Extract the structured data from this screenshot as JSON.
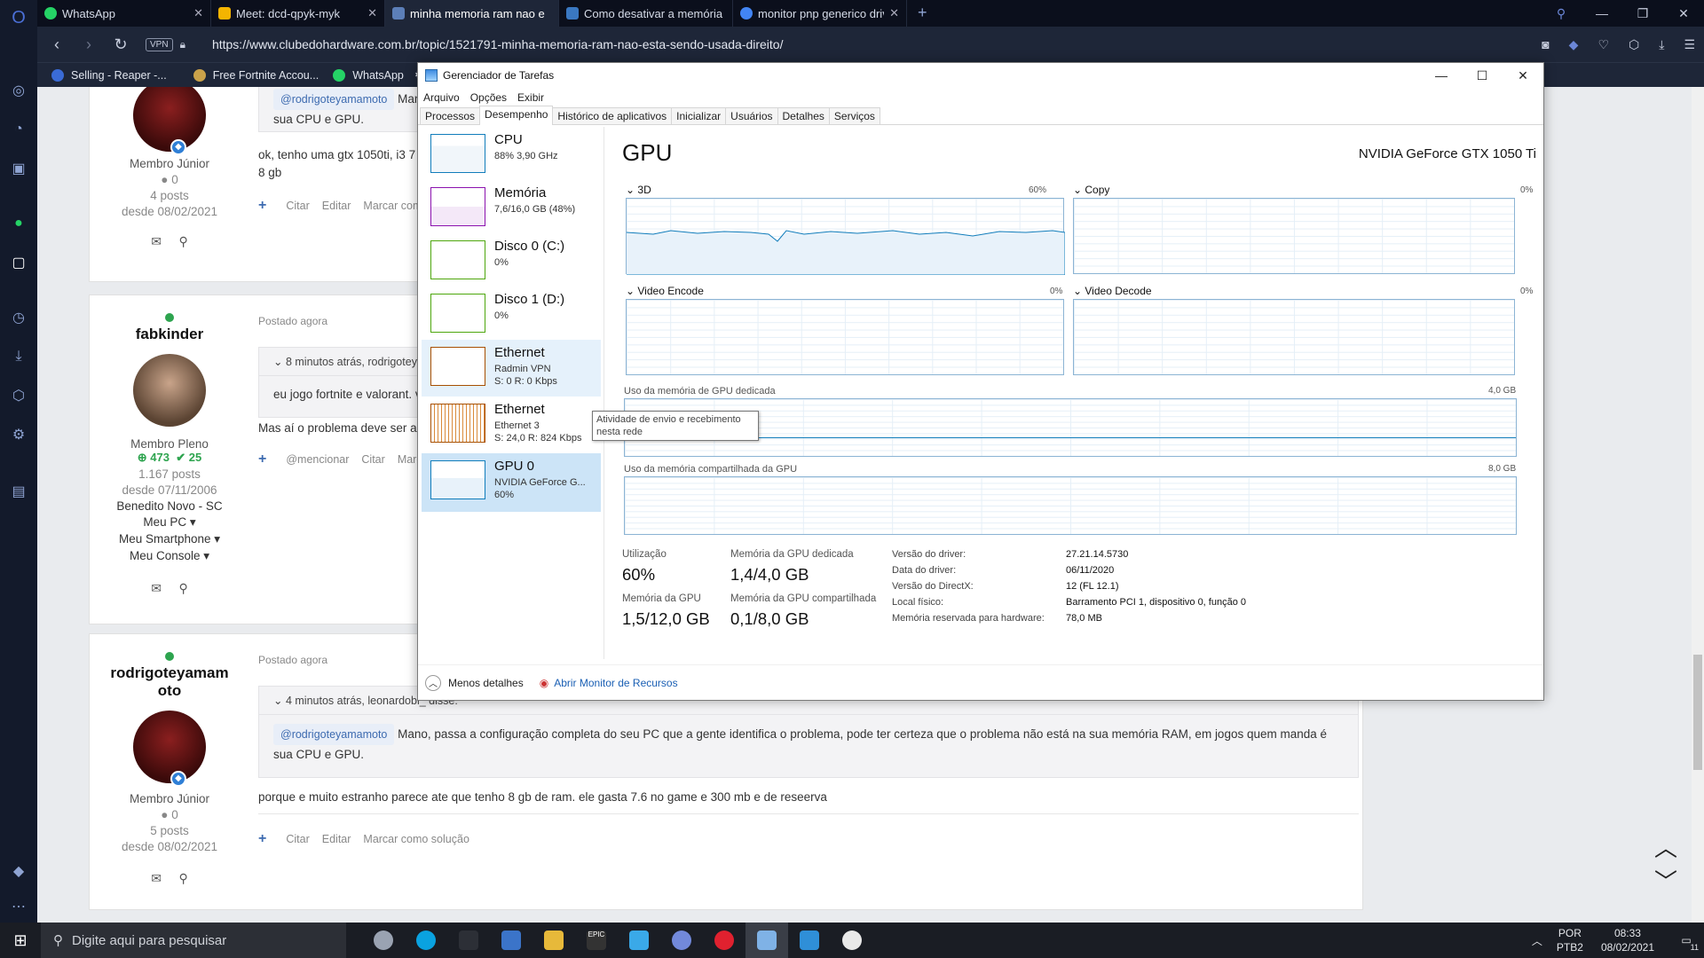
{
  "browser": {
    "tabs": [
      {
        "label": "WhatsApp",
        "color": "#25d366"
      },
      {
        "label": "Meet: dcd-qpyk-myk",
        "color": "#f4b400"
      },
      {
        "label": "minha memoria ram nao e",
        "color": "#5c7fb8"
      },
      {
        "label": "Como desativar a memória",
        "color": "#3a78c2"
      },
      {
        "label": "monitor pnp generico driv",
        "color": "#4285f4"
      }
    ],
    "vpn_label": "VPN",
    "url": "https://www.clubedohardware.com.br/topic/1521791-minha-memoria-ram-nao-esta-sendo-usada-direito/",
    "bookmarks": [
      {
        "label": "Selling - Reaper -...",
        "color": "#3a6bd6"
      },
      {
        "label": "Free Fortnite Accou...",
        "color": "#caa24a"
      },
      {
        "label": "WhatsApp",
        "color": "#25d366"
      }
    ]
  },
  "forum": {
    "posts": [
      {
        "author_rank": "Membro Júnior",
        "reputation": "0",
        "posts": "4 posts",
        "since": "desde 08/02/2021",
        "quote_mention": "@rodrigoteyamamoto",
        "quote_text": "Mano, passa a configuração completa do seu PC que a gente identifica o problema, pode ter certeza que o problema não está na sua memória RAM, em jogos quem manda é sua CPU e GPU.",
        "text": "ok, tenho uma gtx 1050ti, i3 7 g",
        "text2": "8 gb",
        "actions": [
          "Citar",
          "Editar",
          "Marcar como solução"
        ]
      },
      {
        "author": "fabkinder",
        "posted": "Postado agora",
        "quote_head": "8 minutos atrás, rodrigoteyamamoto disse:",
        "quote_text": "eu jogo fortnite e valorant. va",
        "text": "Mas aí o problema deve ser a p",
        "author_rank": "Membro Pleno",
        "rep_plus": "473",
        "rep_check": "25",
        "posts": "1.167 posts",
        "since": "desde 07/11/2006",
        "location": "Benedito Novo - SC",
        "links": [
          "Meu PC",
          "Meu Smartphone",
          "Meu Console"
        ],
        "actions": [
          "@mencionar",
          "Citar",
          "Marc"
        ]
      },
      {
        "author": "rodrigoteyamamoto",
        "posted": "Postado agora",
        "quote_head": "4 minutos atrás, leonardobl_ disse:",
        "quote_mention": "@rodrigoteyamamoto",
        "quote_text": "Mano, passa a configuração completa do seu PC que a gente identifica o problema, pode ter certeza que o problema não está na sua memória RAM, em jogos quem manda é sua CPU e GPU.",
        "text": "porque e muito estranho parece ate que tenho 8 gb de ram. ele gasta 7.6 no game e 300 mb e de reseerva",
        "author_rank": "Membro Júnior",
        "reputation": "0",
        "posts": "5 posts",
        "since": "desde 08/02/2021",
        "actions": [
          "Citar",
          "Editar",
          "Marcar como solução"
        ]
      }
    ]
  },
  "taskmanager": {
    "title": "Gerenciador de Tarefas",
    "menu": [
      "Arquivo",
      "Opções",
      "Exibir"
    ],
    "tabs": [
      "Processos",
      "Desempenho",
      "Histórico de aplicativos",
      "Inicializar",
      "Usuários",
      "Detalhes",
      "Serviços"
    ],
    "resources": [
      {
        "name": "CPU",
        "sub1": "88% 3,90 GHz",
        "sub2": "",
        "sub3": "",
        "color": "#117dbb"
      },
      {
        "name": "Memória",
        "sub1": "7,6/16,0 GB (48%)",
        "sub2": "",
        "sub3": "",
        "color": "#8b12ae"
      },
      {
        "name": "Disco 0 (C:)",
        "sub1": "0%",
        "sub2": "",
        "sub3": "",
        "color": "#4da60c"
      },
      {
        "name": "Disco 1 (D:)",
        "sub1": "0%",
        "sub2": "",
        "sub3": "",
        "color": "#4da60c"
      },
      {
        "name": "Ethernet",
        "sub1": "Radmin VPN",
        "sub2": "S: 0 R: 0 Kbps",
        "sub3": "",
        "color": "#a74f01"
      },
      {
        "name": "Ethernet",
        "sub1": "Ethernet 3",
        "sub2": "S: 24,0 R: 824 Kbps",
        "sub3": "",
        "color": "#a74f01"
      },
      {
        "name": "GPU 0",
        "sub1": "NVIDIA GeForce G...",
        "sub2": "60%",
        "sub3": "",
        "color": "#117dbb"
      }
    ],
    "gpu_title": "GPU",
    "gpu_model": "NVIDIA GeForce GTX 1050 Ti",
    "graphs": {
      "g3d": {
        "label": "3D",
        "max": "60%"
      },
      "copy": {
        "label": "Copy",
        "max": "0%"
      },
      "encode": {
        "label": "Video Encode",
        "max": "0%"
      },
      "decode": {
        "label": "Video Decode",
        "max": "0%"
      },
      "dedicated": {
        "label": "Uso da memória de GPU dedicada",
        "max": "4,0 GB"
      },
      "shared": {
        "label": "Uso da memória compartilhada da GPU",
        "max": "8,0 GB"
      }
    },
    "stats": {
      "util_label": "Utilização",
      "util_value": "60%",
      "ded_label": "Memória da GPU dedicada",
      "ded_value": "1,4/4,0 GB",
      "mem_label": "Memória da GPU",
      "mem_value": "1,5/12,0 GB",
      "shared_label": "Memória da GPU compartilhada",
      "shared_value": "0,1/8,0 GB"
    },
    "details": [
      {
        "k": "Versão do driver:",
        "v": "27.21.14.5730"
      },
      {
        "k": "Data do driver:",
        "v": "06/11/2020"
      },
      {
        "k": "Versão do DirectX:",
        "v": "12 (FL 12.1)"
      },
      {
        "k": "Local físico:",
        "v": "Barramento PCI 1, dispositivo 0, função 0"
      },
      {
        "k": "Memória reservada para hardware:",
        "v": "78,0 MB"
      }
    ],
    "footer": {
      "less": "Menos detalhes",
      "monitor": "Abrir Monitor de Recursos"
    },
    "tooltip": "Atividade de envio e recebimento nesta rede"
  },
  "taskbar": {
    "search_placeholder": "Digite aqui para pesquisar",
    "lang": "POR",
    "layout": "PTB2",
    "time": "08:33",
    "date": "08/02/2021",
    "notif_count": "11"
  }
}
